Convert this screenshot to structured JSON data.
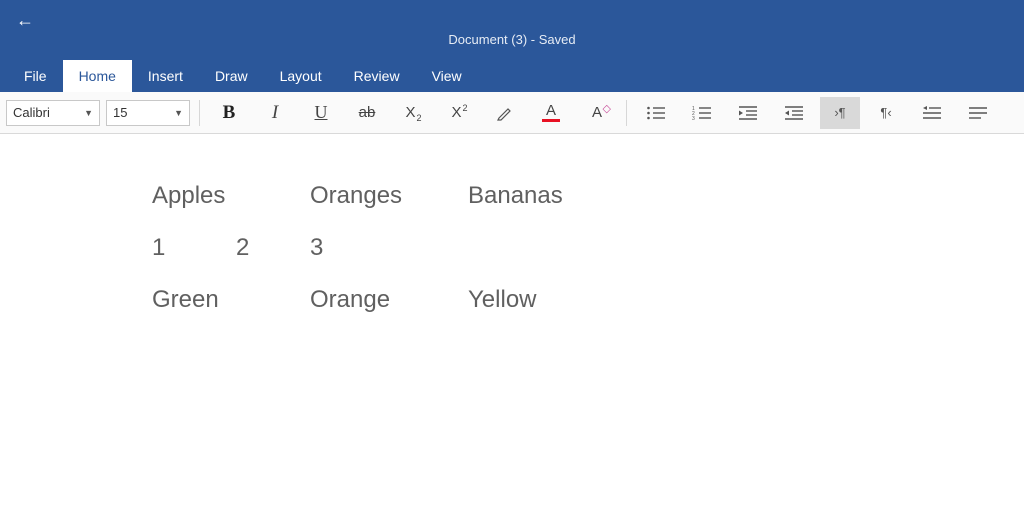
{
  "header": {
    "doc_title": "Document (3) - Saved"
  },
  "menu": {
    "items": [
      "File",
      "Home",
      "Insert",
      "Draw",
      "Layout",
      "Review",
      "View"
    ],
    "active_index": 1
  },
  "ribbon": {
    "font_name": "Calibri",
    "font_size": "15"
  },
  "document": {
    "rows": [
      {
        "cells": [
          "Apples",
          "Oranges",
          "Bananas"
        ],
        "layout": "wide"
      },
      {
        "cells": [
          "1",
          "2",
          "3"
        ],
        "layout": "narrow"
      },
      {
        "cells": [
          "Green",
          "Orange",
          "Yellow"
        ],
        "layout": "wide"
      }
    ]
  }
}
